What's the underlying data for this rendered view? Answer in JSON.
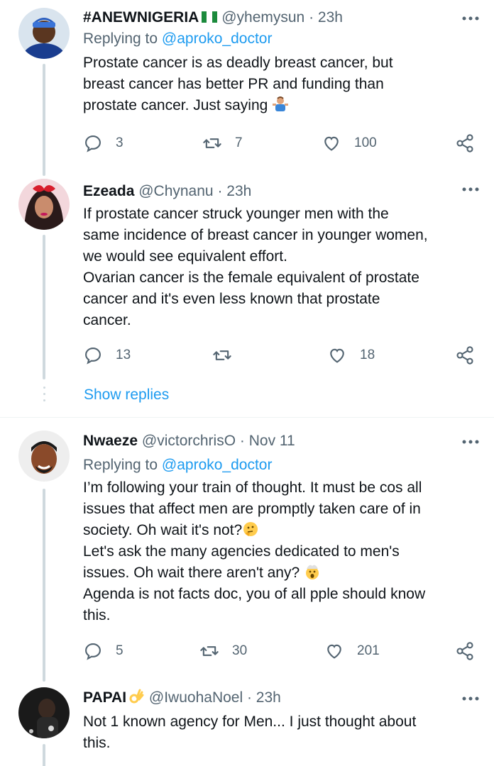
{
  "tweets": [
    {
      "name": "#ANEWNIGERIA",
      "handle": "@yhemysun",
      "time": "· 23h",
      "replying_prefix": "Replying to ",
      "replying_to": "@aproko_doctor",
      "text": "Prostate cancer is as deadly breast cancer, but\nbreast cancer has better PR and funding than\nprostate cancer. Just saying",
      "replies": "3",
      "retweets": "7",
      "likes": "100"
    },
    {
      "name": "Ezeada",
      "handle": "@Chynanu",
      "time": "· 23h",
      "text": "If prostate cancer struck younger men with the\nsame incidence of breast cancer in younger women,\nwe would see equivalent effort.\nOvarian cancer is the female equivalent of prostate\ncancer and it's even less known that prostate\ncancer.",
      "replies": "13",
      "retweets": "",
      "likes": "18"
    },
    {
      "name": "Nwaeze",
      "handle": "@victorchrisO",
      "time": "· Nov 11",
      "replying_prefix": "Replying to ",
      "replying_to": "@aproko_doctor",
      "text_1": "I’m following your train of thought. It must be cos all\nissues that affect men are promptly taken care of in\nsociety. Oh wait it's not?",
      "text_2": "Let's ask the many agencies dedicated to men's\nissues. Oh wait there aren't any?",
      "text_3": "Agenda is not facts doc, you of all pple should know\nthis.",
      "replies": "5",
      "retweets": "30",
      "likes": "201"
    },
    {
      "name": "PAPAI",
      "handle": "@IwuohaNoel",
      "time": "· 23h",
      "text": "Not 1 known agency for Men... I just thought about\nthis."
    }
  ],
  "show_replies": "Show replies",
  "colors": {
    "link": "#1d9bf0",
    "secondary": "#536471",
    "line": "#cfd9de"
  }
}
